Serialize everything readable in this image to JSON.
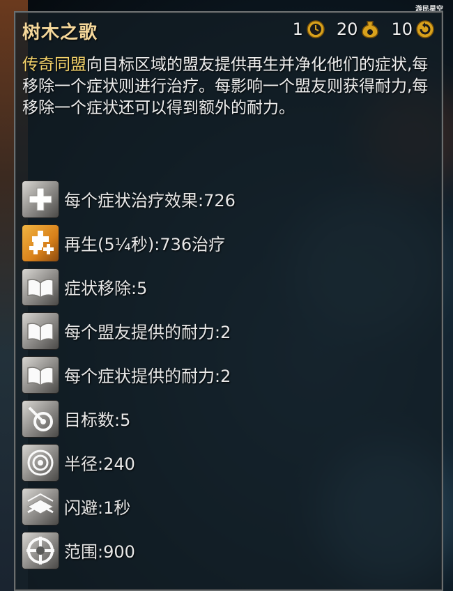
{
  "watermark": "游民星空",
  "skill": {
    "title": "树木之歌",
    "stats": [
      {
        "value": "1",
        "icon": "activation-time-icon"
      },
      {
        "value": "20",
        "icon": "energy-cost-icon"
      },
      {
        "value": "10",
        "icon": "recharge-icon"
      }
    ],
    "description_highlight": "传奇同盟",
    "description_rest": "向目标区域的盟友提供再生并净化他们的症状,每移除一个症状则进行治疗。每影响一个盟友则获得耐力,每移除一个症状还可以得到额外的耐力。"
  },
  "facts": [
    {
      "icon": "heal-cross-icon",
      "text": "每个症状治疗效果:726"
    },
    {
      "icon": "regeneration-icon",
      "text": "再生(5¼秒):736治疗"
    },
    {
      "icon": "book-icon",
      "text": "症状移除:5"
    },
    {
      "icon": "book-icon",
      "text": "每个盟友提供的耐力:2"
    },
    {
      "icon": "book-icon",
      "text": "每个症状提供的耐力:2"
    },
    {
      "icon": "target-count-icon",
      "text": "目标数:5"
    },
    {
      "icon": "radius-icon",
      "text": "半径:240"
    },
    {
      "icon": "evade-icon",
      "text": "闪避:1秒"
    },
    {
      "icon": "range-icon",
      "text": "范围:900"
    }
  ]
}
